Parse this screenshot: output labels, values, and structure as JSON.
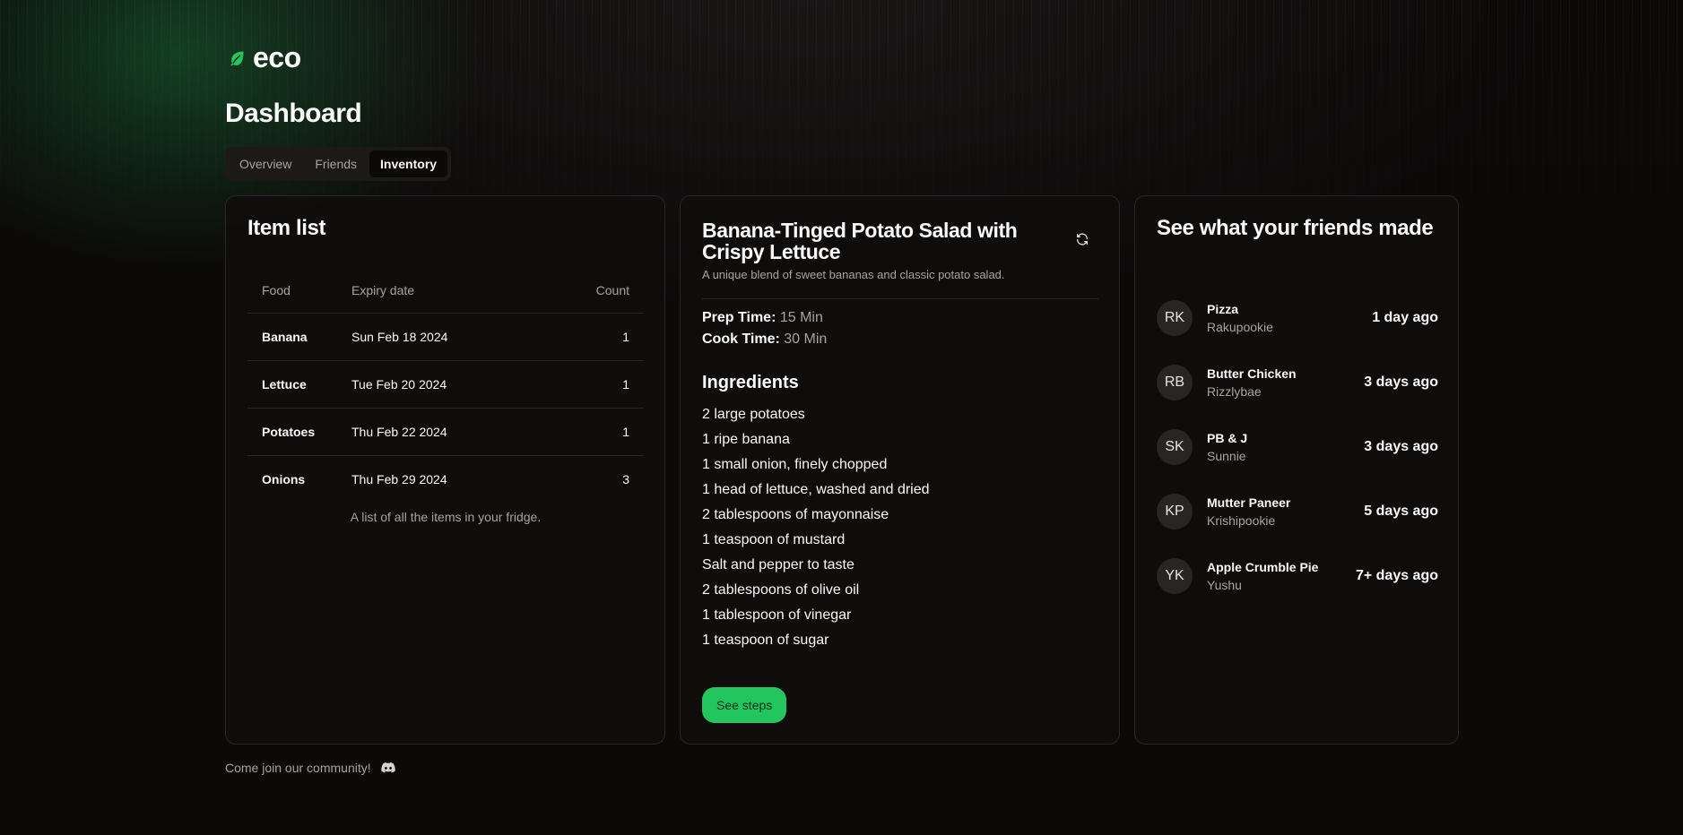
{
  "brand": {
    "name": "eco",
    "accent": "#22c55e"
  },
  "page": {
    "title": "Dashboard"
  },
  "tabs": [
    {
      "label": "Overview",
      "active": false
    },
    {
      "label": "Friends",
      "active": false
    },
    {
      "label": "Inventory",
      "active": true
    }
  ],
  "item_list": {
    "title": "Item list",
    "headers": {
      "food": "Food",
      "expiry": "Expiry date",
      "count": "Count"
    },
    "rows": [
      {
        "food": "Banana",
        "expiry": "Sun Feb 18 2024",
        "count": "1"
      },
      {
        "food": "Lettuce",
        "expiry": "Tue Feb 20 2024",
        "count": "1"
      },
      {
        "food": "Potatoes",
        "expiry": "Thu Feb 22 2024",
        "count": "1"
      },
      {
        "food": "Onions",
        "expiry": "Thu Feb 29 2024",
        "count": "3"
      }
    ],
    "caption": "A list of all the items in your fridge."
  },
  "recipe": {
    "title": "Banana-Tinged Potato Salad with Crispy Lettuce",
    "description": "A unique blend of sweet bananas and classic potato salad.",
    "prep_label": "Prep Time:",
    "prep_value": "15 Min",
    "cook_label": "Cook Time:",
    "cook_value": "30 Min",
    "ingredients_heading": "Ingredients",
    "ingredients": [
      "2 large potatoes",
      "1 ripe banana",
      "1 small onion, finely chopped",
      "1 head of lettuce, washed and dried",
      "2 tablespoons of mayonnaise",
      "1 teaspoon of mustard",
      "Salt and pepper to taste",
      "2 tablespoons of olive oil",
      "1 tablespoon of vinegar",
      "1 teaspoon of sugar"
    ],
    "steps_button": "See steps",
    "refresh_icon": "refresh-icon"
  },
  "friends": {
    "title": "See what your friends made",
    "items": [
      {
        "initials": "RK",
        "dish": "Pizza",
        "user": "Rakupookie",
        "time": "1 day ago"
      },
      {
        "initials": "RB",
        "dish": "Butter Chicken",
        "user": "Rizzlybae",
        "time": "3 days ago"
      },
      {
        "initials": "SK",
        "dish": "PB & J",
        "user": "Sunnie",
        "time": "3 days ago"
      },
      {
        "initials": "KP",
        "dish": "Mutter Paneer",
        "user": "Krishipookie",
        "time": "5 days ago"
      },
      {
        "initials": "YK",
        "dish": "Apple Crumble Pie",
        "user": "Yushu",
        "time": "7+ days ago"
      }
    ]
  },
  "footer": {
    "text": "Come join our community!",
    "icon": "discord-icon"
  }
}
